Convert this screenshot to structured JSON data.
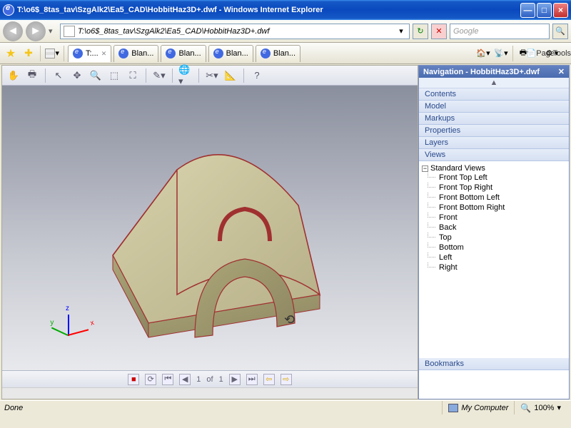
{
  "titlebar": {
    "text": "T:\\o6$_8tas_tav\\SzgAlk2\\Ea5_CAD\\HobbitHaz3D+.dwf - Windows Internet Explorer"
  },
  "address": {
    "text": "T:\\o6$_8tas_tav\\SzgAlk2\\Ea5_CAD\\HobbitHaz3D+.dwf"
  },
  "search": {
    "placeholder": "Google"
  },
  "tabs": [
    {
      "label": "T:..."
    },
    {
      "label": "Blan..."
    },
    {
      "label": "Blan..."
    },
    {
      "label": "Blan..."
    },
    {
      "label": "Blan..."
    }
  ],
  "favtools": {
    "page": "Page",
    "tools": "Tools"
  },
  "pager": {
    "current": "1",
    "of": "of",
    "total": "1"
  },
  "navpanel": {
    "title": "Navigation - HobbitHaz3D+.dwf",
    "sections": {
      "contents": "Contents",
      "model": "Model",
      "markups": "Markups",
      "properties": "Properties",
      "layers": "Layers",
      "views": "Views",
      "bookmarks": "Bookmarks"
    },
    "tree_root": "Standard Views",
    "views": [
      "Front Top Left",
      "Front Top Right",
      "Front Bottom Left",
      "Front Bottom Right",
      "Front",
      "Back",
      "Top",
      "Bottom",
      "Left",
      "Right"
    ]
  },
  "status": {
    "done": "Done",
    "zone": "My Computer",
    "zoom": "100%"
  }
}
